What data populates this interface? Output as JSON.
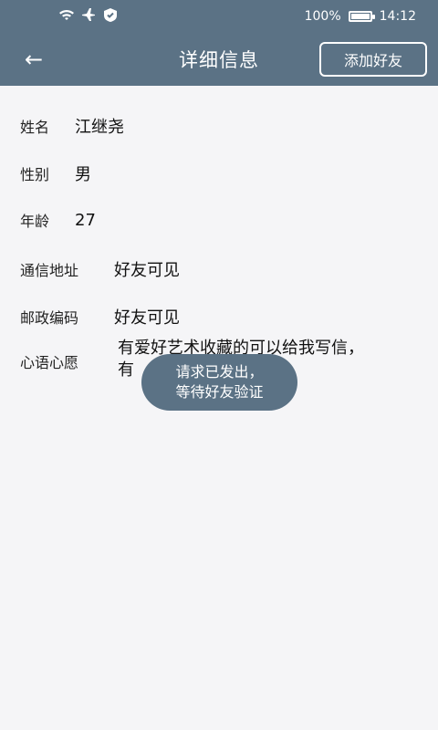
{
  "statusbar": {
    "battery": "100%",
    "time": "14:12",
    "icons": [
      "wifi-icon",
      "airplane-icon",
      "shield-icon"
    ]
  },
  "appbar": {
    "title": "详细信息",
    "add_friend": "添加好友",
    "background_color": "#5b7285"
  },
  "details": {
    "name_label": "姓名",
    "name_value": "江继尧",
    "gender_label": "性别",
    "gender_value": "男",
    "age_label": "年龄",
    "age_value": "27",
    "address_label": "通信地址",
    "address_value": "好友可见",
    "zipcode_label": "邮政编码",
    "zipcode_value": "好友可见",
    "wish_label": "心语心愿",
    "wish_line1": "有爱好艺术收藏的可以给我写信，",
    "wish_line2": "有"
  },
  "toast": {
    "line1": "请求已发出，",
    "line2": "等待好友验证"
  }
}
